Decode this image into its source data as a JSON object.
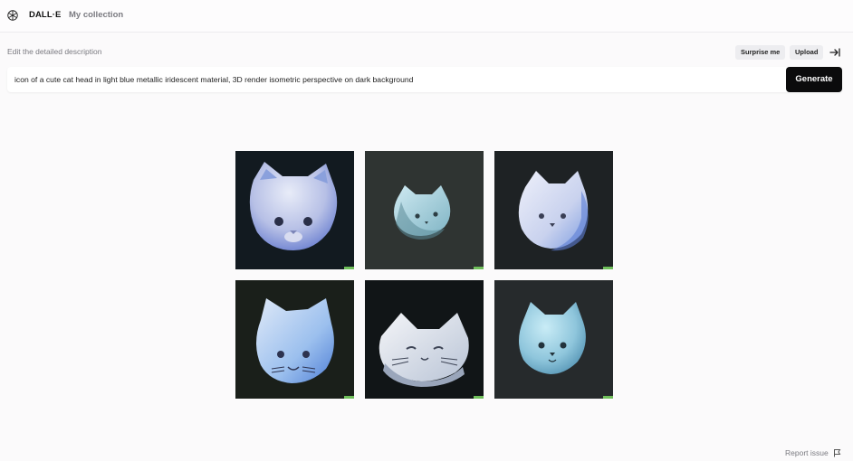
{
  "app": {
    "brand": "DALL·E",
    "nav_collection": "My collection"
  },
  "editor": {
    "description_label": "Edit the detailed description",
    "surprise_label": "Surprise me",
    "upload_label": "Upload",
    "prompt_value": "icon of a cute cat head in light blue metallic iridescent material, 3D render isometric perspective on dark background",
    "generate_label": "Generate"
  },
  "results": {
    "images": [
      {
        "alt": "cat head render 1"
      },
      {
        "alt": "cat head render 2"
      },
      {
        "alt": "cat head render 3"
      },
      {
        "alt": "cat head render 4"
      },
      {
        "alt": "cat head render 5"
      },
      {
        "alt": "cat head render 6"
      }
    ]
  },
  "footer": {
    "report_label": "Report issue"
  },
  "colors": {
    "accent_black": "#0b0b0c",
    "cat_blue": "#a8c8ea",
    "signature_green": "#6fbf5a"
  },
  "icons": {
    "logo": "openai-logo-icon",
    "collapse": "arrow-collapse-icon",
    "flag": "flag-icon"
  }
}
